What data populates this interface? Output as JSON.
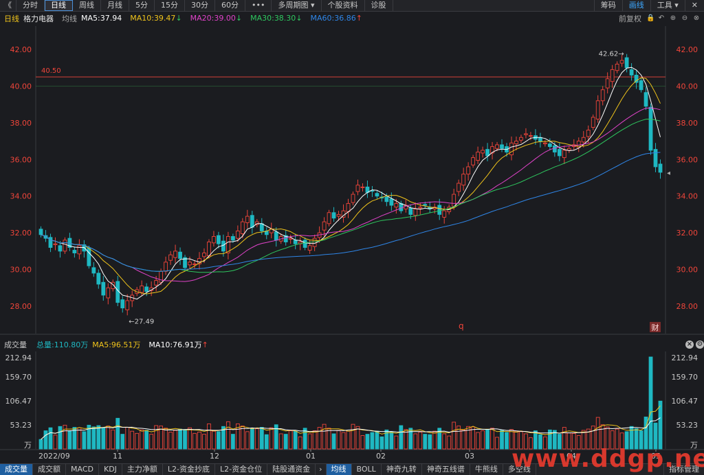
{
  "toolbar": {
    "back": "《",
    "periods": [
      "分时",
      "日线",
      "周线",
      "月线",
      "5分",
      "15分",
      "30分",
      "60分"
    ],
    "active_period": "日线",
    "more": "•••",
    "multi_period": "多周期图",
    "stock_info": "个股资料",
    "diagnose": "诊股",
    "right": {
      "chips": "筹码",
      "draw": "画线",
      "tools": "工具"
    }
  },
  "price_panel": {
    "period_label": "日线",
    "stock_name": "格力电器",
    "avg_label": "均线",
    "ma5": "MA5:37.94",
    "ma10": "MA10:39.47",
    "ma20": "MA20:39.00",
    "ma30": "MA30:38.30",
    "ma60": "MA60:36.86",
    "ma_arrow_down": "↓",
    "ma_arrow_up": "↑",
    "adjust": "前复权",
    "y_labels": [
      "42.00",
      "40.00",
      "38.00",
      "36.00",
      "34.00",
      "32.00",
      "30.00",
      "28.00"
    ],
    "ref_line_label": "40.50",
    "high_label": "42.62→",
    "low_label": "←27.49",
    "marker_q": "q",
    "marker_cai": "财",
    "cursor": "◂"
  },
  "volume_panel": {
    "title": "成交量",
    "total": "总量:110.80万",
    "ma5": "MA5:96.51万",
    "ma10": "MA10:76.91万",
    "up_arrow": "↑",
    "y_labels": [
      "212.94",
      "159.70",
      "106.47",
      "53.23",
      "万"
    ],
    "x_labels": [
      "2022/09",
      "11",
      "12",
      "01",
      "02",
      "03",
      "04",
      "05"
    ]
  },
  "bottom_tabs": {
    "left": [
      "成交量",
      "成交额",
      "MACD",
      "KDJ",
      "主力净额",
      "L2-资金抄底",
      "L2-资金仓位",
      "陆股通资金"
    ],
    "active_left": "成交量",
    "arrow": "›",
    "right": [
      "均线",
      "BOLL",
      "神奇九转",
      "神奇五线谱",
      "牛熊线",
      "多空线"
    ],
    "active_right": "均线",
    "last": "指标管理"
  },
  "watermark": "www.ddgp.net",
  "colors": {
    "up": "#f0453a",
    "down": "#1fb8c2",
    "ma5": "#ffffff",
    "ma10": "#f0c41b",
    "ma20": "#e043c9",
    "ma30": "#2ec85f",
    "ma60": "#2f86e8",
    "axis_text": "#f0453a",
    "bg": "#1b1c20"
  },
  "chart_data": {
    "type": "candlestick",
    "symbol": "格力电器",
    "ylim": [
      27.0,
      43.0
    ],
    "close_series": [
      31.9,
      31.7,
      31.2,
      31.4,
      31.0,
      31.6,
      31.2,
      30.9,
      31.3,
      31.0,
      30.2,
      29.8,
      29.2,
      28.6,
      29.0,
      29.3,
      28.2,
      27.9,
      28.3,
      28.6,
      28.9,
      29.1,
      28.8,
      29.0,
      29.4,
      29.9,
      30.4,
      30.8,
      31.0,
      30.6,
      30.1,
      30.4,
      30.3,
      30.6,
      30.9,
      31.5,
      31.8,
      31.4,
      31.0,
      31.8,
      31.6,
      32.1,
      32.6,
      32.9,
      32.3,
      32.6,
      32.1,
      31.9,
      32.2,
      31.6,
      31.8,
      31.5,
      31.7,
      31.4,
      31.5,
      31.2,
      31.3,
      31.7,
      32.0,
      32.6,
      33.1,
      32.8,
      33.0,
      33.2,
      33.6,
      34.1,
      34.6,
      34.5,
      34.2,
      34.3,
      34.0,
      33.9,
      33.7,
      33.5,
      33.6,
      33.2,
      33.5,
      33.0,
      33.3,
      33.4,
      33.5,
      33.3,
      33.4,
      33.0,
      33.2,
      33.4,
      34.1,
      34.7,
      35.2,
      35.6,
      36.1,
      36.4,
      36.5,
      36.2,
      36.7,
      36.8,
      36.6,
      36.4,
      36.9,
      37.0,
      37.2,
      37.4,
      37.3,
      37.1,
      37.0,
      36.9,
      36.7,
      36.4,
      36.2,
      36.5,
      36.6,
      36.8,
      37.0,
      37.2,
      37.6,
      38.3,
      39.2,
      39.8,
      40.4,
      40.9,
      41.2,
      41.4,
      41.0,
      40.6,
      40.2,
      39.8,
      38.9,
      36.5,
      35.6,
      35.3
    ]
  }
}
